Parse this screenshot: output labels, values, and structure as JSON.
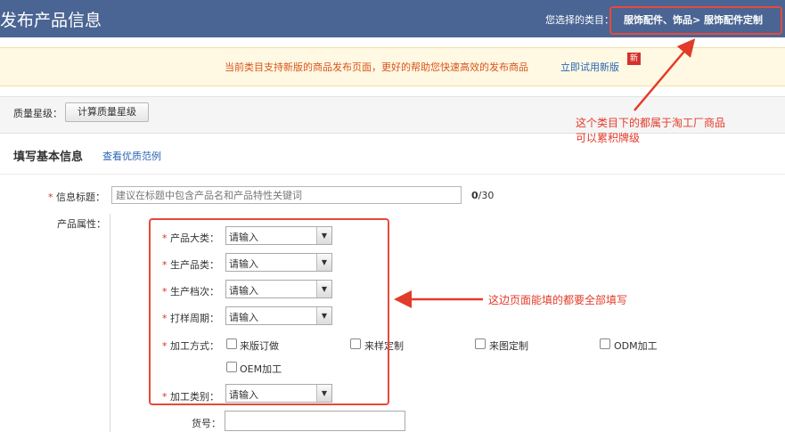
{
  "header": {
    "page_title": "发布产品信息",
    "category_label": "您选择的类目：",
    "category_path": "服饰配件、饰品> 服饰配件定制"
  },
  "notice": {
    "text": "当前类目支持新版的商品发布页面，更好的帮助您快速高效的发布商品",
    "link": "立即试用新版",
    "badge": "新"
  },
  "quality": {
    "label": "质量星级：",
    "button": "计算质量星级"
  },
  "section": {
    "title": "填写基本信息",
    "example_link": "查看优质范例"
  },
  "form": {
    "required_mark": "*",
    "title_label": "信息标题：",
    "title_placeholder": "建议在标题中包含产品名和产品特性关键词",
    "title_count_current": "0",
    "title_count_max": "/30",
    "attributes_label": "产品属性：",
    "attributes": [
      {
        "label": "产品大类：",
        "value": "请输入"
      },
      {
        "label": "生产品类：",
        "value": "请输入"
      },
      {
        "label": "生产档次：",
        "value": "请输入"
      },
      {
        "label": "打样周期：",
        "value": "请输入"
      }
    ],
    "processing_label": "加工方式：",
    "processing_options": [
      "来版订做",
      "来样定制",
      "来图定制",
      "ODM加工",
      "OEM加工"
    ],
    "processing_type_label": "加工类别：",
    "processing_type_value": "请输入",
    "item_code_label": "货号："
  },
  "annotations": {
    "category_note_line1": "这个类目下的都属于淘工厂商品",
    "category_note_line2": "可以累积牌级",
    "fields_note": "这边页面能填的都要全部填写",
    "color": "#e33b2a"
  },
  "colors": {
    "header_bg": "#4a6593",
    "notice_bg": "#fff9e3",
    "notice_text": "#d9531a",
    "link": "#2a64b3",
    "required": "#d8312b"
  }
}
